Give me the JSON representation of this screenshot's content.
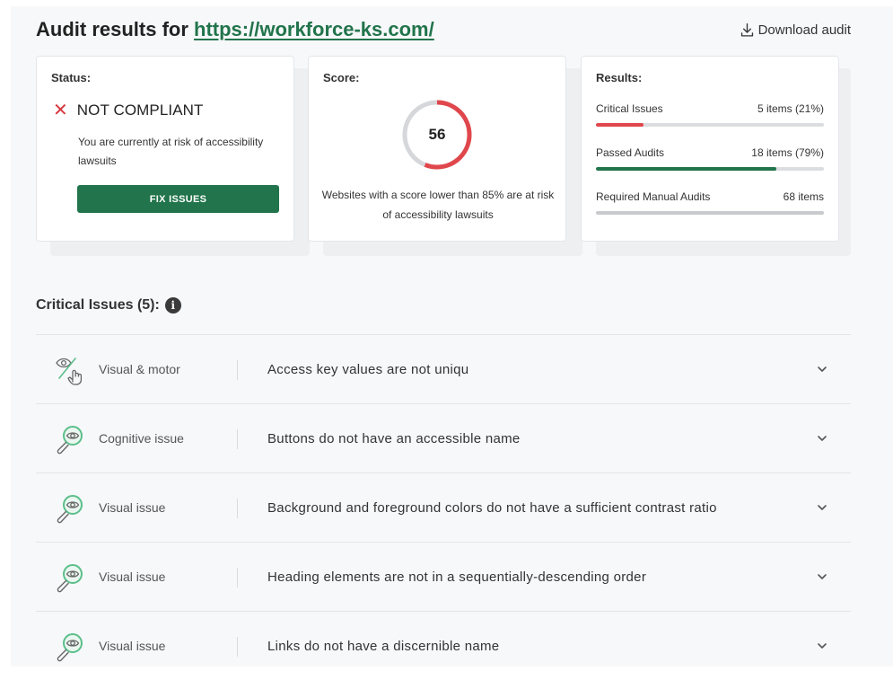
{
  "header": {
    "title_prefix": "Audit results for ",
    "url": "https://workforce-ks.com/",
    "download_label": "Download audit"
  },
  "status_card": {
    "label": "Status:",
    "status": "NOT COMPLIANT",
    "description": "You are currently at risk of accessibility lawsuits",
    "fix_button": "FIX ISSUES"
  },
  "score_card": {
    "label": "Score:",
    "score": "56",
    "score_value": 56,
    "description": "Websites with a score lower than 85% are at risk of accessibility lawsuits"
  },
  "results_card": {
    "label": "Results:",
    "rows": [
      {
        "name": "Critical Issues",
        "value": "5 items (21%)",
        "fill": 0.21,
        "color": "#e0474c"
      },
      {
        "name": "Passed Audits",
        "value": "18 items (79%)",
        "fill": 0.79,
        "color": "#21744b"
      },
      {
        "name": "Required Manual Audits",
        "value": "68 items",
        "fill": 1.0,
        "color": "#c9cacd"
      }
    ]
  },
  "critical": {
    "title": "Critical Issues (5):",
    "info_icon": "i",
    "issues": [
      {
        "icon": "visual-motor-icon",
        "category": "Visual & motor",
        "description": "Access key values are not uniqu"
      },
      {
        "icon": "magnifier-eye-icon",
        "category": "Cognitive issue",
        "description": "Buttons do not have an accessible name"
      },
      {
        "icon": "magnifier-eye-icon",
        "category": "Visual issue",
        "description": "Background and foreground colors do not have a sufficient contrast ratio"
      },
      {
        "icon": "magnifier-eye-icon",
        "category": "Visual issue",
        "description": "Heading elements are not in a sequentially-descending order"
      },
      {
        "icon": "magnifier-eye-icon",
        "category": "Visual issue",
        "description": "Links do not have a discernible name"
      }
    ]
  },
  "colors": {
    "brand_green": "#21744b",
    "danger_red": "#d9363e",
    "gauge_red": "#e0474c",
    "gauge_track": "#d6d7da"
  }
}
